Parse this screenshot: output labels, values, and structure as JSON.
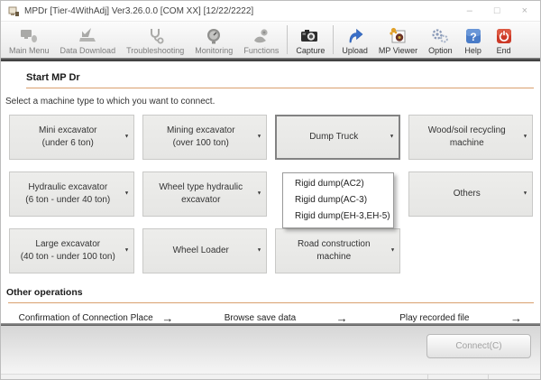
{
  "window": {
    "title": "MPDr [Tier-4WithAdj] Ver3.26.0.0 [COM XX] [12/22/2222]",
    "minimize": "–",
    "maximize": "□",
    "close": "×"
  },
  "toolbar": {
    "buttons": [
      {
        "label": "Main Menu",
        "enabled": false
      },
      {
        "label": "Data Download",
        "enabled": false
      },
      {
        "label": "Troubleshooting",
        "enabled": false
      },
      {
        "label": "Monitoring",
        "enabled": false
      },
      {
        "label": "Functions",
        "enabled": false
      },
      {
        "label": "Capture",
        "enabled": true
      },
      {
        "label": "Upload",
        "enabled": true
      },
      {
        "label": "MP Viewer",
        "enabled": true
      },
      {
        "label": "Option",
        "enabled": true
      },
      {
        "label": "Help",
        "enabled": true
      },
      {
        "label": "End",
        "enabled": true
      }
    ]
  },
  "main": {
    "section_title": "Start MP Dr",
    "instruction": "Select a machine type to which you want to connect.",
    "machine_grid": {
      "arrow_glyph": "▼",
      "cells": [
        {
          "line1": "Mini excavator",
          "line2": "(under 6 ton)"
        },
        {
          "line1": "Mining excavator",
          "line2": "(over 100 ton)"
        },
        {
          "line1": "Dump Truck"
        },
        {
          "line1": "Wood/soil recycling machine"
        },
        {
          "line1": "Hydraulic excavator",
          "line2": "(6 ton - under 40 ton)"
        },
        {
          "line1": "Wheel type hydraulic excavator"
        },
        {
          "line1": "Others"
        },
        {
          "line1": "Large excavator",
          "line2": "(40 ton - under 100 ton)"
        },
        {
          "line1": "Wheel Loader"
        },
        {
          "line1": "Road construction machine"
        }
      ]
    },
    "dump_truck_dropdown": {
      "items": [
        "Rigid dump(AC2)",
        "Rigid dump(AC-3)",
        "Rigid dump(EH-3,EH-5)"
      ]
    },
    "other_operations": {
      "title": "Other operations",
      "arrow_glyph": "→",
      "links": [
        "Confirmation of Connection Place",
        "Browse save data",
        "Play recorded file"
      ]
    }
  },
  "footer": {
    "connect_label": "Connect(C)"
  },
  "colors": {
    "accent_underline": "#d9a06e",
    "end_red": "#cc3a28",
    "help_blue": "#4a7cc8",
    "upload_blue": "#3a6fc8",
    "button_bg": "#e9e9e7"
  }
}
